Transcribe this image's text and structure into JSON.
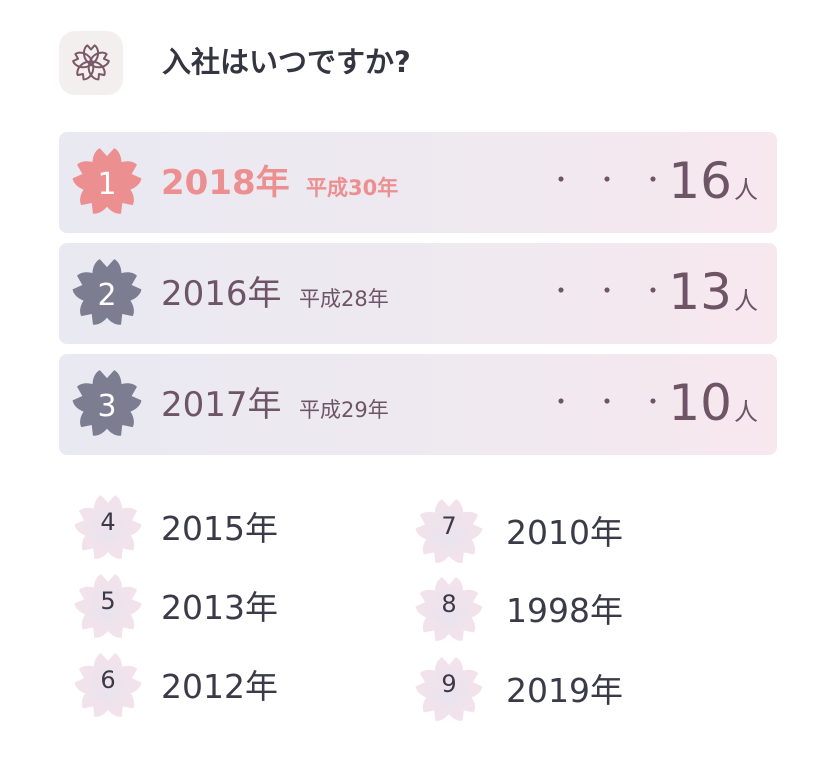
{
  "header": {
    "icon": "sakura-outline-icon",
    "title": "入社はいつですか?"
  },
  "colors": {
    "first_accent": "#ec8f90",
    "dark_flower": "#7c7d90",
    "text_mauve": "#6e5566",
    "light_flower_top": "#f5e2ea",
    "light_flower_bottom": "#e6e4ef"
  },
  "top_ranks": [
    {
      "rank": "1",
      "year": "2018年",
      "era": "平成30年",
      "dots": "・・・",
      "count": "16",
      "unit": "人",
      "icon": "sakura-icon"
    },
    {
      "rank": "2",
      "year": "2016年",
      "era": "平成28年",
      "dots": "・・・",
      "count": "13",
      "unit": "人",
      "icon": "sakura-icon"
    },
    {
      "rank": "3",
      "year": "2017年",
      "era": "平成29年",
      "dots": "・・・",
      "count": "10",
      "unit": "人",
      "icon": "sakura-icon"
    }
  ],
  "other_ranks": [
    {
      "rank": "4",
      "year": "2015年"
    },
    {
      "rank": "5",
      "year": "2013年"
    },
    {
      "rank": "6",
      "year": "2012年"
    },
    {
      "rank": "7",
      "year": "2010年"
    },
    {
      "rank": "8",
      "year": "1998年"
    },
    {
      "rank": "9",
      "year": "2019年"
    }
  ]
}
